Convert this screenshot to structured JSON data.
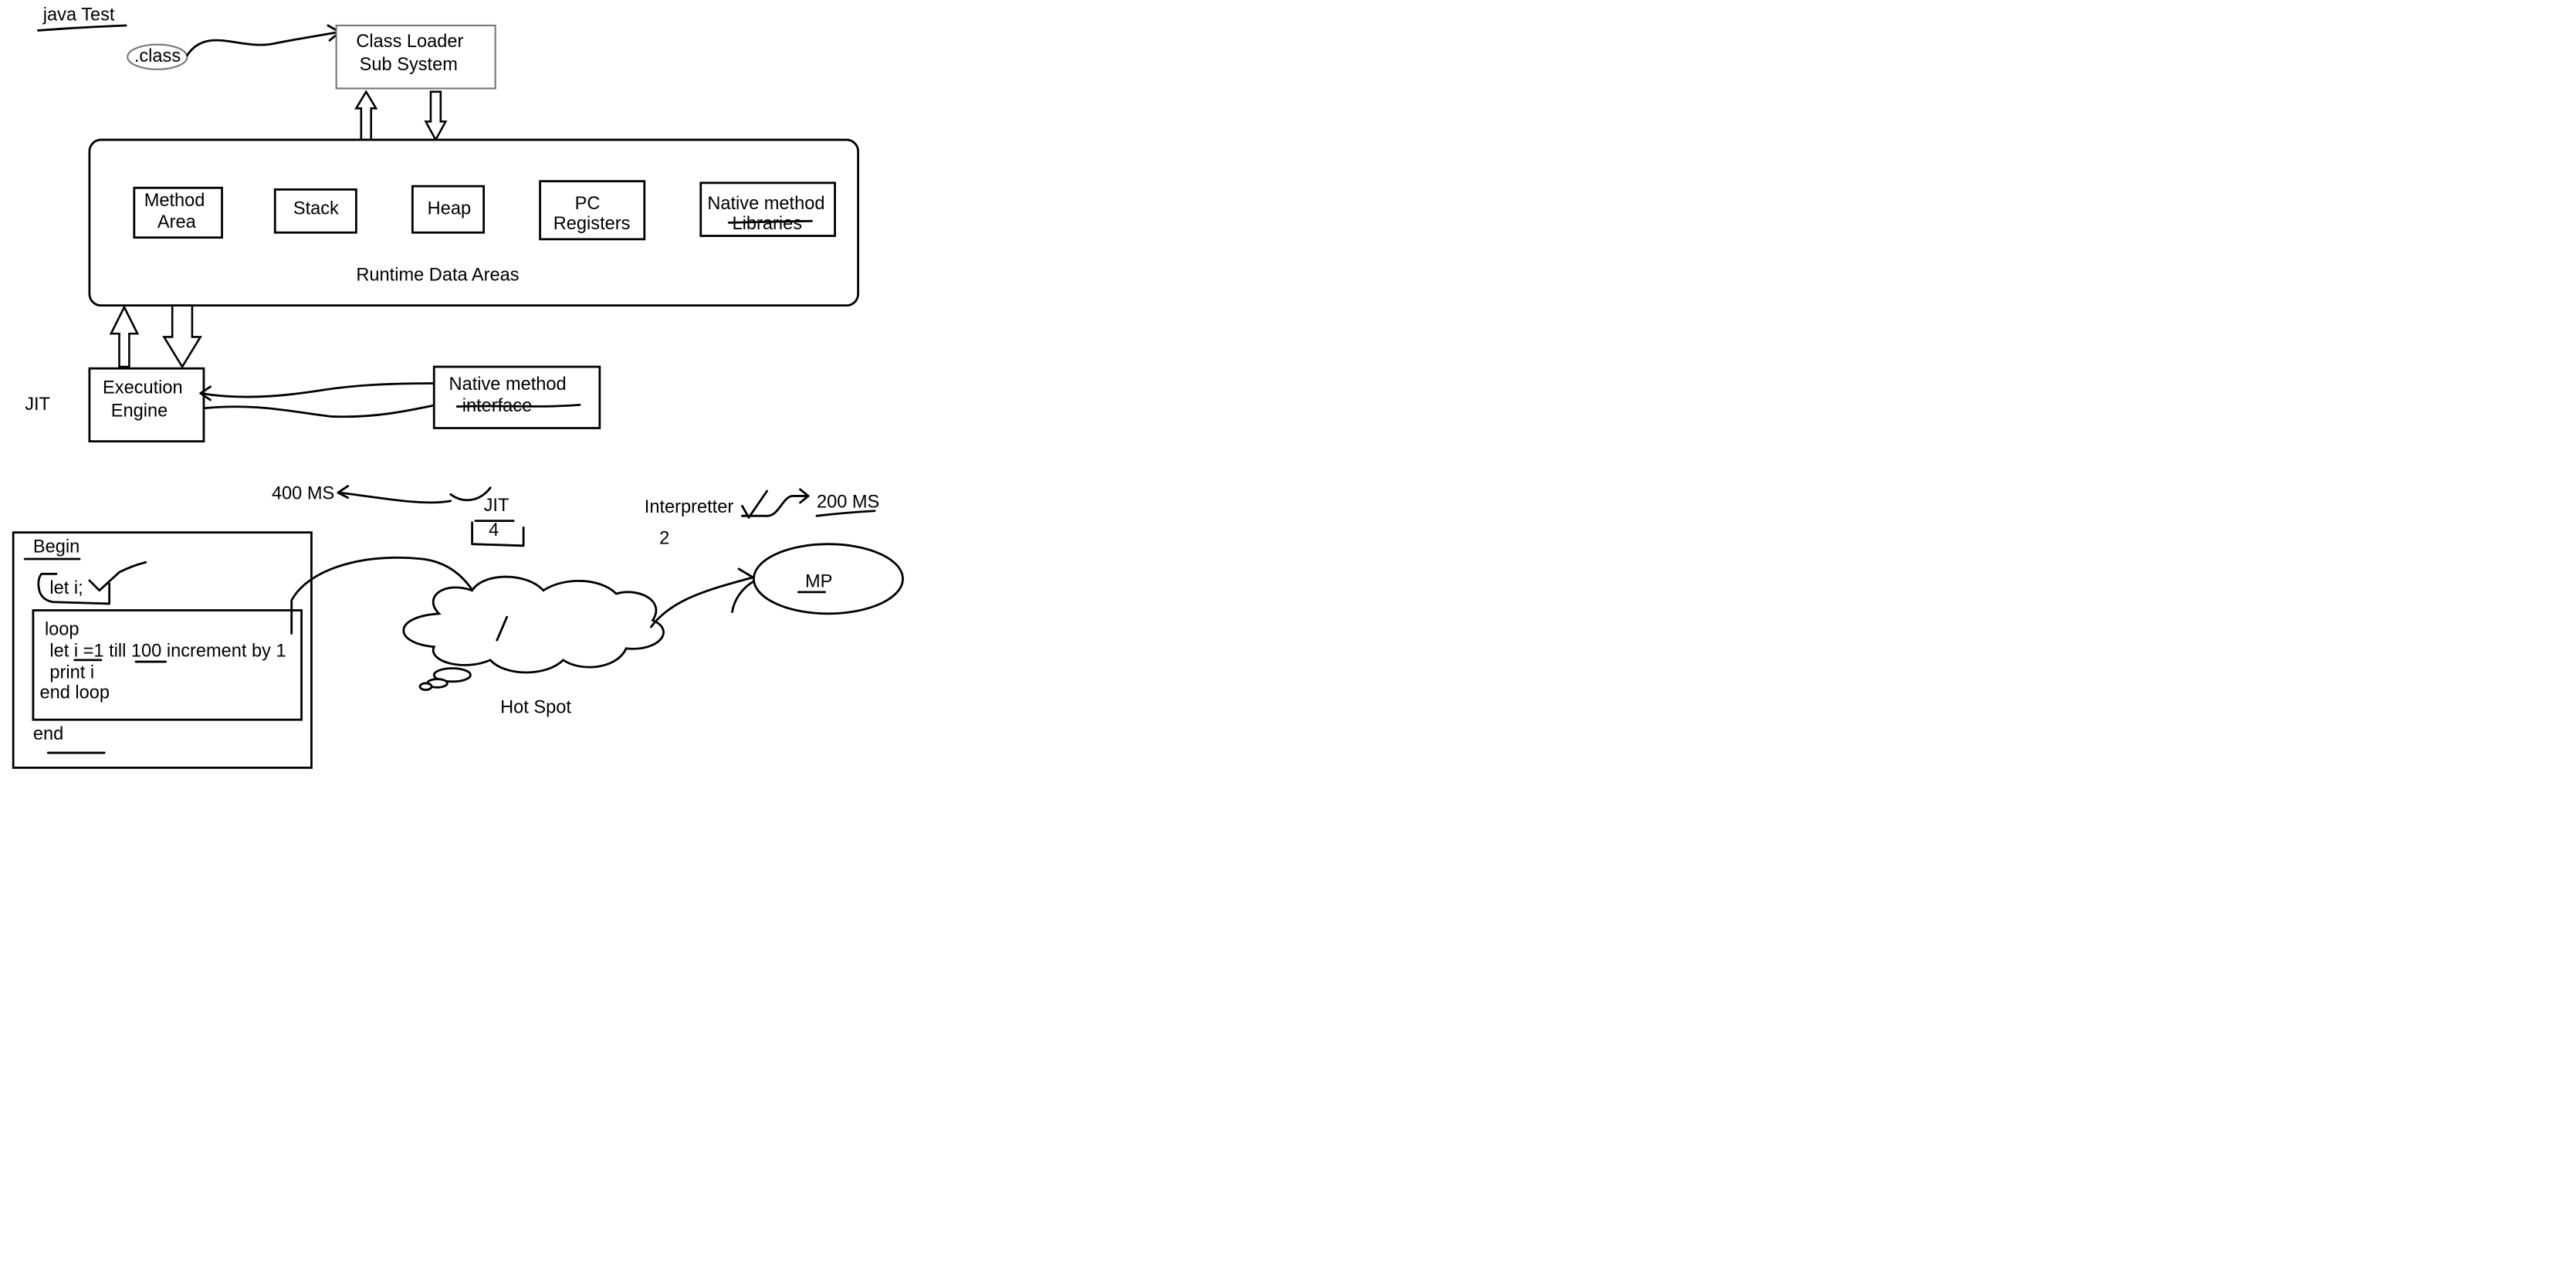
{
  "title": "java Test",
  "class_label": ".class",
  "class_loader": {
    "line1": "Class Loader",
    "line2": "Sub System"
  },
  "runtime": {
    "label": "Runtime Data Areas",
    "method_area": {
      "line1": "Method",
      "line2": "Area"
    },
    "stack": "Stack",
    "heap": "Heap",
    "pc_registers": {
      "line1": "PC",
      "line2": "Registers"
    },
    "native_libraries": {
      "line1": "Native method",
      "line2": "Libraries"
    }
  },
  "execution_engine": {
    "line1": "Execution",
    "line2": "Engine"
  },
  "jit_side_label": "JIT",
  "native_interface": {
    "line1": "Native method",
    "line2": "interface"
  },
  "timing": {
    "jit_ms": "400 MS",
    "jit_label": "JIT",
    "jit_count": "4",
    "interpreter_label": "Interpretter",
    "interpreter_ms": "200 MS",
    "interpreter_count": "2"
  },
  "code": {
    "begin": "Begin",
    "let_i": "let i;",
    "loop": "loop",
    "let_line": "let i =1 till 100 increment by 1",
    "print_line": "print i",
    "end_loop": "end loop",
    "end": "end"
  },
  "hot_spot_label": "Hot Spot",
  "mp_label": "MP"
}
